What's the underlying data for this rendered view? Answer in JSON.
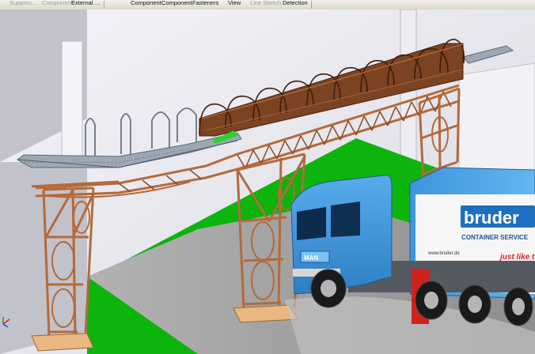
{
  "toolbar": {
    "items": [
      {
        "label": "Suppres…",
        "enabled": false
      },
      {
        "label": "Component",
        "enabled": false
      },
      {
        "label": "External …",
        "enabled": true
      },
      {
        "label": "Component",
        "enabled": true
      },
      {
        "label": "Component",
        "enabled": true
      },
      {
        "label": "Fasteners",
        "enabled": true
      },
      {
        "label": "View",
        "enabled": true
      },
      {
        "label": "Line Sketch",
        "enabled": false
      },
      {
        "label": "Detection",
        "enabled": true
      }
    ]
  },
  "scene": {
    "truck": {
      "brand": "bruder",
      "service_label": "CONTAINER SERVICE",
      "slogan": "just like th",
      "website": "www.bruder.de",
      "cab_badge": "MAN"
    },
    "colors": {
      "steel": "#b46a3a",
      "steel_dark": "#6f3b1c",
      "roof": "#7b4322",
      "lawn": "#0cb40c",
      "road": "#9a9a9a",
      "cab": "#3d93d8",
      "container": "#4aa2e6",
      "brand_red": "#e52121",
      "base_plate": "#e9b77f"
    }
  }
}
